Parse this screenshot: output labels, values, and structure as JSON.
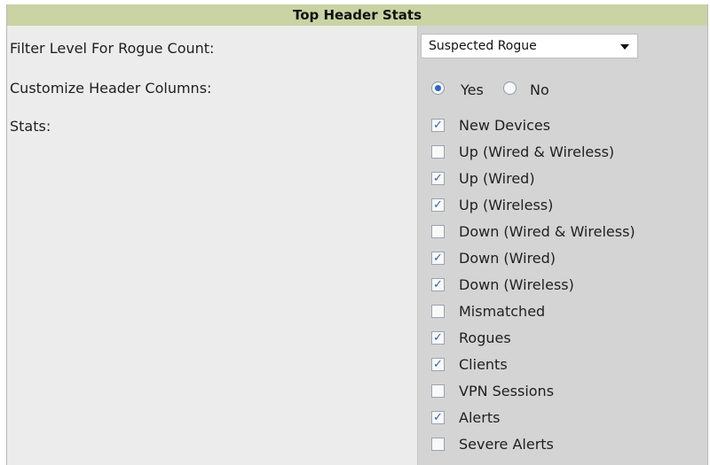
{
  "panel": {
    "title": "Top Header Stats"
  },
  "filter": {
    "label": "Filter Level For Rogue Count:",
    "selected": "Suspected Rogue"
  },
  "customize": {
    "label": "Customize Header Columns:",
    "options": [
      {
        "label": "Yes",
        "checked": true
      },
      {
        "label": "No",
        "checked": false
      }
    ]
  },
  "stats": {
    "label": "Stats:",
    "items": [
      {
        "label": "New Devices",
        "checked": true
      },
      {
        "label": "Up (Wired & Wireless)",
        "checked": false
      },
      {
        "label": "Up (Wired)",
        "checked": true
      },
      {
        "label": "Up (Wireless)",
        "checked": true
      },
      {
        "label": "Down (Wired & Wireless)",
        "checked": false
      },
      {
        "label": "Down (Wired)",
        "checked": true
      },
      {
        "label": "Down (Wireless)",
        "checked": true
      },
      {
        "label": "Mismatched",
        "checked": false
      },
      {
        "label": "Rogues",
        "checked": true
      },
      {
        "label": "Clients",
        "checked": true
      },
      {
        "label": "VPN Sessions",
        "checked": false
      },
      {
        "label": "Alerts",
        "checked": true
      },
      {
        "label": "Severe Alerts",
        "checked": false
      }
    ]
  }
}
